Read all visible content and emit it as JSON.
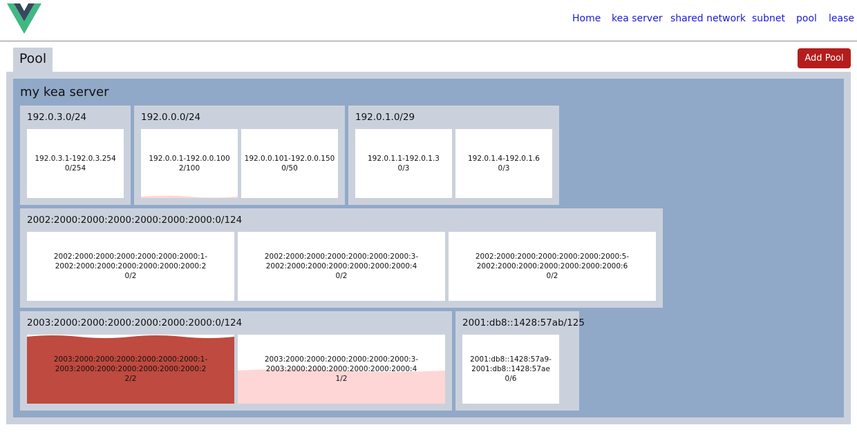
{
  "nav": {
    "links": [
      "Home",
      "kea server",
      "shared network",
      "subnet",
      "pool",
      "lease"
    ]
  },
  "page": {
    "tab_label": "Pool",
    "add_button": "Add Pool"
  },
  "server": {
    "name": "my kea server",
    "subnets": [
      {
        "cidr": "192.0.3.0/24",
        "pools": [
          {
            "range_start": "192.0.3.1-192.0.3.254",
            "range_end": "",
            "usage": "0/254",
            "utilization": 0
          }
        ]
      },
      {
        "cidr": "192.0.0.0/24",
        "pools": [
          {
            "range_start": "192.0.0.1-192.0.0.100",
            "range_end": "",
            "usage": "2/100",
            "utilization": 0.02
          },
          {
            "range_start": "192.0.0.101-192.0.0.150",
            "range_end": "",
            "usage": "0/50",
            "utilization": 0
          }
        ]
      },
      {
        "cidr": "192.0.1.0/29",
        "pools": [
          {
            "range_start": "192.0.1.1-192.0.1.3",
            "range_end": "",
            "usage": "0/3",
            "utilization": 0
          },
          {
            "range_start": "192.0.1.4-192.0.1.6",
            "range_end": "",
            "usage": "0/3",
            "utilization": 0
          }
        ]
      },
      {
        "cidr": "2002:2000:2000:2000:2000:2000:2000:0/124",
        "pools": [
          {
            "range_start": "2002:2000:2000:2000:2000:2000:2000:1-",
            "range_end": "2002:2000:2000:2000:2000:2000:2000:2",
            "usage": "0/2",
            "utilization": 0
          },
          {
            "range_start": "2002:2000:2000:2000:2000:2000:2000:3-",
            "range_end": "2002:2000:2000:2000:2000:2000:2000:4",
            "usage": "0/2",
            "utilization": 0
          },
          {
            "range_start": "2002:2000:2000:2000:2000:2000:2000:5-",
            "range_end": "2002:2000:2000:2000:2000:2000:2000:6",
            "usage": "0/2",
            "utilization": 0
          }
        ]
      },
      {
        "cidr": "2003:2000:2000:2000:2000:2000:2000:0/124",
        "pools": [
          {
            "range_start": "2003:2000:2000:2000:2000:2000:2000:1-",
            "range_end": "2003:2000:2000:2000:2000:2000:2000:2",
            "usage": "2/2",
            "utilization": 1
          },
          {
            "range_start": "2003:2000:2000:2000:2000:2000:2000:3-",
            "range_end": "2003:2000:2000:2000:2000:2000:2000:4",
            "usage": "1/2",
            "utilization": 0.5
          }
        ]
      },
      {
        "cidr": "2001:db8::1428:57ab/125",
        "pools": [
          {
            "range_start": "2001:db8::1428:57a9-",
            "range_end": "2001:db8::1428:57ae",
            "usage": "0/6",
            "utilization": 0
          }
        ]
      }
    ]
  },
  "colors": {
    "logo_green": "#41b883",
    "logo_dark": "#35495e",
    "nav_link": "#1a1ad8",
    "add_button_bg": "#b51d1d",
    "panel_bg": "#cbd1dc",
    "server_bg": "#91a9c8",
    "pool_full": "#bf4a3f",
    "pool_partial": "#ffd6d6",
    "pool_low": "#ffd6d6"
  }
}
